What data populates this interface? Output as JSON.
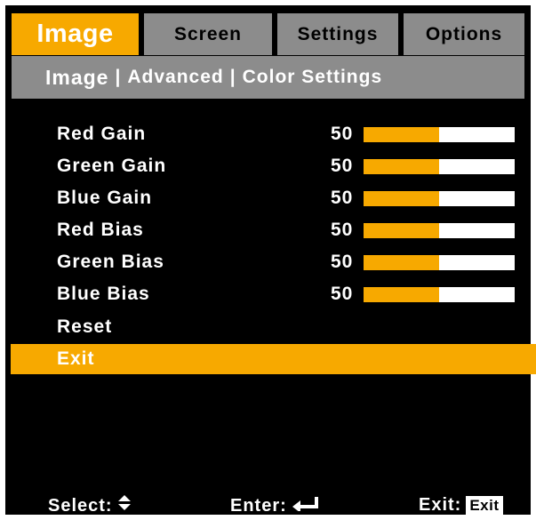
{
  "tabs": [
    {
      "label": "Image",
      "active": true
    },
    {
      "label": "Screen",
      "active": false
    },
    {
      "label": "Settings",
      "active": false
    },
    {
      "label": "Options",
      "active": false
    }
  ],
  "subheader": {
    "current": "Image",
    "separator": "|",
    "items": [
      "Advanced",
      "Color Settings"
    ]
  },
  "menu": {
    "rows": [
      {
        "label": "Red Gain",
        "value": "50",
        "level_percent": 50
      },
      {
        "label": "Green Gain",
        "value": "50",
        "level_percent": 50
      },
      {
        "label": "Blue Gain",
        "value": "50",
        "level_percent": 50
      },
      {
        "label": "Red Bias",
        "value": "50",
        "level_percent": 50
      },
      {
        "label": "Green Bias",
        "value": "50",
        "level_percent": 50
      },
      {
        "label": "Blue Bias",
        "value": "50",
        "level_percent": 50
      },
      {
        "label": "Reset"
      },
      {
        "label": "Exit",
        "selected": true
      }
    ]
  },
  "footer": {
    "select_label": "Select:",
    "select_icon": "up-down-arrows-icon",
    "enter_label": "Enter:",
    "enter_icon": "enter-return-icon",
    "exit_label": "Exit:",
    "exit_key": "Exit"
  },
  "colors": {
    "accent": "#f7a900",
    "tab_inactive": "#8c8c8c",
    "background": "#000000",
    "bar_track": "#ffffff"
  }
}
